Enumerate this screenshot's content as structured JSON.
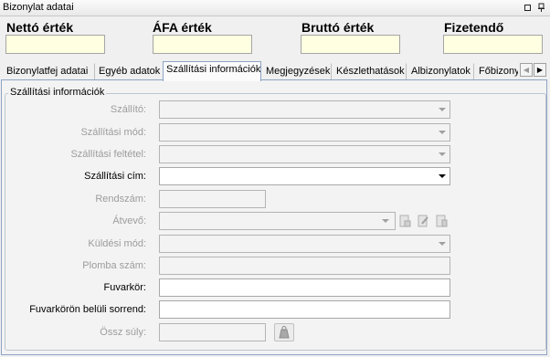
{
  "window": {
    "title": "Bizonylat adatai"
  },
  "totals": {
    "net_label": "Nettó érték",
    "vat_label": "ÁFA érték",
    "gross_label": "Bruttó érték",
    "payable_label": "Fizetendő"
  },
  "tabs": [
    {
      "label": "Bizonylatfej adatai"
    },
    {
      "label": "Egyéb adatok"
    },
    {
      "label": "Szállítási információk"
    },
    {
      "label": "Megjegyzések"
    },
    {
      "label": "Készlethatások"
    },
    {
      "label": "Albizonylatok"
    },
    {
      "label": "Főbizonylatok"
    }
  ],
  "active_tab": "Szállítási információk",
  "section": {
    "title": "Szállítási információk",
    "fields": {
      "szallito": "Szállító:",
      "szallitasi_mod": "Szállítási mód:",
      "szallitasi_feltetel": "Szállítási feltétel:",
      "szallitasi_cim": "Szállítási cím:",
      "rendszam": "Rendszám:",
      "atvevo": "Átvevő:",
      "kuldesi_mod": "Küldési mód:",
      "plomba_szam": "Plomba szám:",
      "fuvarkor": "Fuvarkör:",
      "fuvarkor_sorrend": "Fuvarkörön belüli sorrend:",
      "ossz_suly": "Össz súly:"
    }
  },
  "colors": {
    "total_field_bg": "#ffffe1",
    "tab_border": "#8ea4c4",
    "disabled_text": "#9c9c9c"
  }
}
